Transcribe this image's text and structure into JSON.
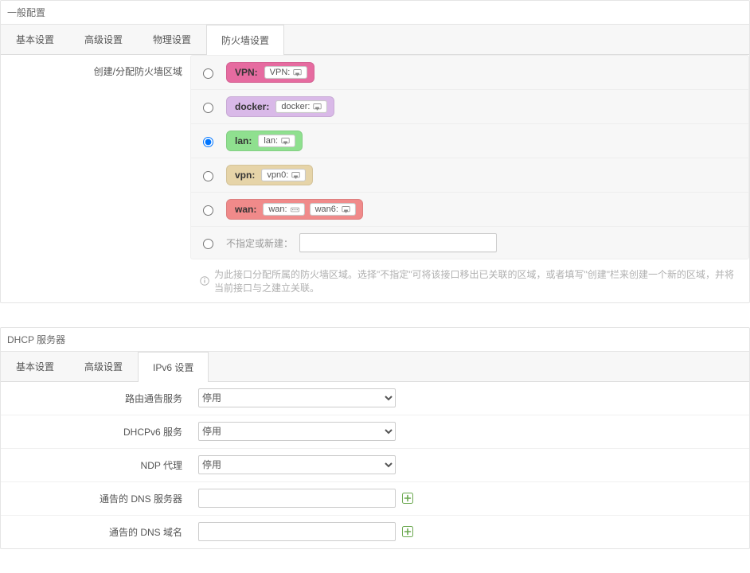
{
  "general": {
    "title": "一般配置",
    "tabs": [
      "基本设置",
      "高级设置",
      "物理设置",
      "防火墙设置"
    ],
    "activeTab": 3,
    "firewall": {
      "label": "创建/分配防火墙区域",
      "selectedIndex": 2,
      "zones": [
        {
          "name": "VPN:",
          "bg": "#e66ba0",
          "ifaces": [
            {
              "label": "VPN:",
              "iconType": "wired"
            }
          ]
        },
        {
          "name": "docker:",
          "bg": "#d9b9e8",
          "ifaces": [
            {
              "label": "docker:",
              "iconType": "wired"
            }
          ]
        },
        {
          "name": "lan:",
          "bg": "#8fe08f",
          "ifaces": [
            {
              "label": "lan:",
              "iconType": "wired"
            }
          ]
        },
        {
          "name": "vpn:",
          "bg": "#e6d4a8",
          "ifaces": [
            {
              "label": "vpn0:",
              "iconType": "wired"
            }
          ]
        },
        {
          "name": "wan:",
          "bg": "#f08a8a",
          "ifaces": [
            {
              "label": "wan:",
              "iconType": "switch"
            },
            {
              "label": "wan6:",
              "iconType": "wired"
            }
          ]
        }
      ],
      "createLabel": "不指定或新建：",
      "hint": "为此接口分配所属的防火墙区域。选择\"不指定\"可将该接口移出已关联的区域，或者填写\"创建\"栏来创建一个新的区域，并将当前接口与之建立关联。"
    }
  },
  "dhcp": {
    "title": "DHCP 服务器",
    "tabs": [
      "基本设置",
      "高级设置",
      "IPv6 设置"
    ],
    "activeTab": 2,
    "ipv6": {
      "rows": [
        {
          "label": "路由通告服务",
          "type": "select",
          "value": "停用"
        },
        {
          "label": "DHCPv6 服务",
          "type": "select",
          "value": "停用"
        },
        {
          "label": "NDP 代理",
          "type": "select",
          "value": "停用"
        },
        {
          "label": "通告的 DNS 服务器",
          "type": "text-add",
          "value": ""
        },
        {
          "label": "通告的 DNS 域名",
          "type": "text-add",
          "value": ""
        }
      ]
    }
  }
}
